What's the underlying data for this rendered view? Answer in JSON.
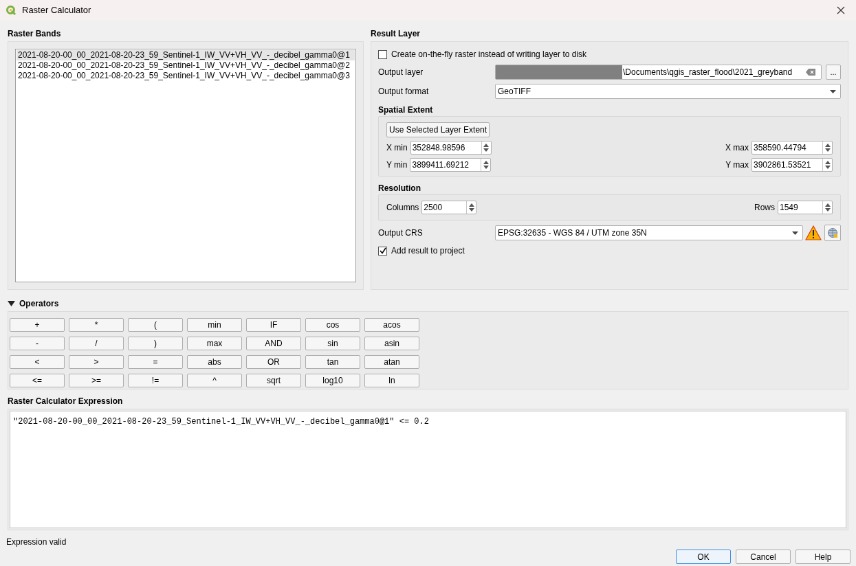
{
  "window": {
    "title": "Raster Calculator"
  },
  "raster_bands": {
    "title": "Raster Bands",
    "items": [
      {
        "label": "2021-08-20-00_00_2021-08-20-23_59_Sentinel-1_IW_VV+VH_VV_-_decibel_gamma0@1",
        "selected": true
      },
      {
        "label": "2021-08-20-00_00_2021-08-20-23_59_Sentinel-1_IW_VV+VH_VV_-_decibel_gamma0@2",
        "selected": false
      },
      {
        "label": "2021-08-20-00_00_2021-08-20-23_59_Sentinel-1_IW_VV+VH_VV_-_decibel_gamma0@3",
        "selected": false
      }
    ]
  },
  "result_layer": {
    "title": "Result Layer",
    "on_the_fly": {
      "label": "Create on-the-fly raster instead of writing layer to disk",
      "checked": false
    },
    "output_layer": {
      "label": "Output layer",
      "value": "\\Documents\\qgis_raster_flood\\2021_greyband",
      "browse": "..."
    },
    "output_format": {
      "label": "Output format",
      "value": "GeoTIFF"
    },
    "spatial_extent": {
      "title": "Spatial Extent",
      "button": "Use Selected Layer Extent",
      "fields": [
        {
          "label": "X min",
          "value": "352848.98596"
        },
        {
          "label": "X max",
          "value": "358590.44794"
        },
        {
          "label": "Y min",
          "value": "3899411.69212"
        },
        {
          "label": "Y max",
          "value": "3902861.53521"
        }
      ]
    },
    "resolution": {
      "title": "Resolution",
      "fields": [
        {
          "label": "Columns",
          "value": "2500"
        },
        {
          "label": "Rows",
          "value": "1549"
        }
      ]
    },
    "output_crs": {
      "label": "Output CRS",
      "value": "EPSG:32635 - WGS 84 / UTM zone 35N"
    },
    "add_to_project": {
      "label": "Add result to project",
      "checked": true
    }
  },
  "operators": {
    "title": "Operators",
    "expanded": true,
    "buttons": [
      "+",
      "*",
      "(",
      "min",
      "IF",
      "cos",
      "acos",
      "-",
      "/",
      ")",
      "max",
      "AND",
      "sin",
      "asin",
      "<",
      ">",
      "=",
      "abs",
      "OR",
      "tan",
      "atan",
      "<=",
      ">=",
      "!=",
      "^",
      "sqrt",
      "log10",
      "ln"
    ]
  },
  "expression": {
    "title": "Raster Calculator Expression",
    "value": "\"2021-08-20-00_00_2021-08-20-23_59_Sentinel-1_IW_VV+VH_VV_-_decibel_gamma0@1\" <= 0.2"
  },
  "status": "Expression valid",
  "buttons": [
    {
      "label": "OK",
      "default": true
    },
    {
      "label": "Cancel",
      "default": false
    },
    {
      "label": "Help",
      "default": false
    }
  ]
}
